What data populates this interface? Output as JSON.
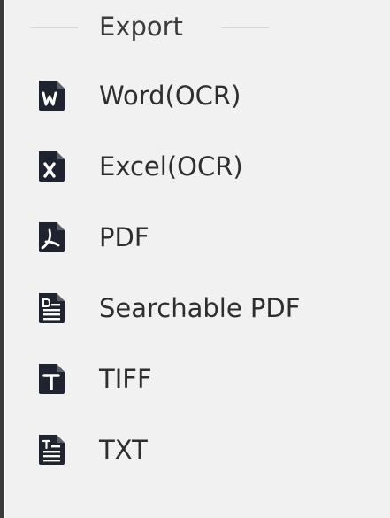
{
  "export_menu": {
    "title": "Export",
    "items": [
      {
        "label": "Word(OCR)",
        "icon": "word-icon"
      },
      {
        "label": "Excel(OCR)",
        "icon": "excel-icon"
      },
      {
        "label": "PDF",
        "icon": "pdf-icon"
      },
      {
        "label": "Searchable PDF",
        "icon": "searchable-pdf-icon"
      },
      {
        "label": "TIFF",
        "icon": "tiff-icon"
      },
      {
        "label": "TXT",
        "icon": "txt-icon"
      }
    ]
  },
  "colors": {
    "icon": "#1f2330",
    "text": "#2e2e2e",
    "panel_bg": "#f1f1f1"
  }
}
